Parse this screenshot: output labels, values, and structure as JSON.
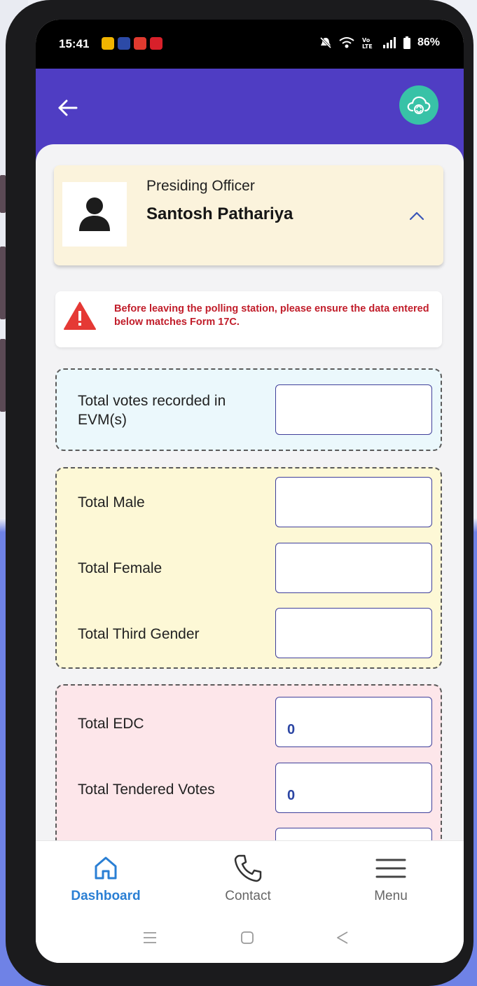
{
  "status_bar": {
    "time": "15:41",
    "battery": "86%",
    "app_colors": [
      "#f0b400",
      "#2c4aa7",
      "#e03a2f",
      "#d8202a"
    ]
  },
  "header": {
    "back_icon": "arrow-left-icon",
    "cloud_icon": "cloud-sync-icon",
    "bar_color": "#4f3dc3"
  },
  "officer": {
    "role": "Presiding Officer",
    "name": "Santosh Pathariya"
  },
  "warning": {
    "text": "Before leaving the polling station, please ensure the data entered below matches Form 17C."
  },
  "form": {
    "evm_votes": {
      "label": "Total votes recorded in EVM(s)",
      "value": ""
    },
    "total_male": {
      "label": "Total Male",
      "value": ""
    },
    "total_female": {
      "label": "Total Female",
      "value": ""
    },
    "total_third_gender": {
      "label": "Total Third Gender",
      "value": ""
    },
    "total_edc": {
      "label": "Total EDC",
      "value": "0"
    },
    "total_tendered": {
      "label": "Total Tendered Votes",
      "value": "0"
    },
    "next_partial": {
      "value": ""
    }
  },
  "bottom_nav": {
    "dashboard": "Dashboard",
    "contact": "Contact",
    "menu": "Menu",
    "active_color": "#2a7fd4"
  }
}
